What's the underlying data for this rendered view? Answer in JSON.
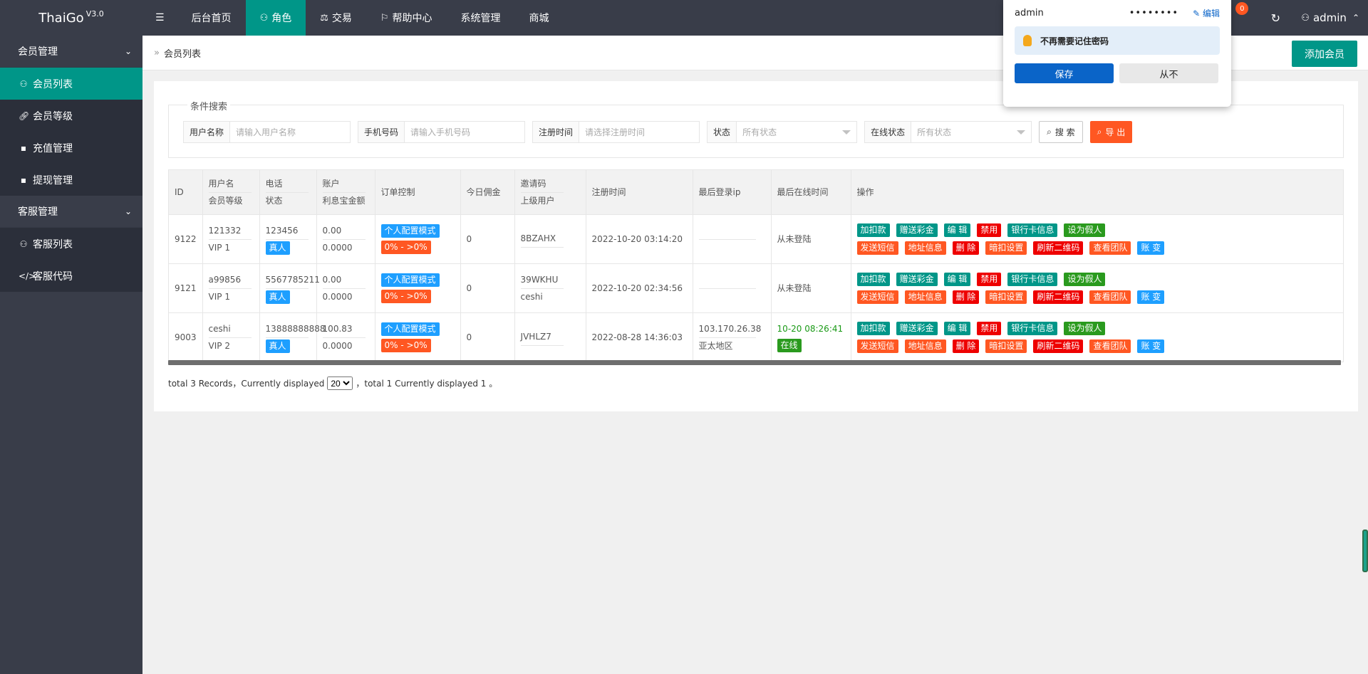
{
  "app": {
    "name": "ThaiGo",
    "version": "V3.0"
  },
  "topnav": {
    "items": [
      {
        "label": "后台首页",
        "icon": ""
      },
      {
        "label": "角色",
        "icon": "user-icon",
        "active": true
      },
      {
        "label": "交易",
        "icon": "scale-icon"
      },
      {
        "label": "帮助中心",
        "icon": "flag-icon"
      },
      {
        "label": "系统管理",
        "icon": ""
      },
      {
        "label": "商城",
        "icon": ""
      }
    ],
    "badge": "0",
    "user": "admin"
  },
  "sidebar": {
    "groups": [
      {
        "label": "会员管理",
        "items": [
          {
            "label": "会员列表",
            "icon": "user-icon",
            "active": true
          },
          {
            "label": "会员等级",
            "icon": "link-icon"
          },
          {
            "label": "充值管理",
            "icon": "chat-icon"
          },
          {
            "label": "提现管理",
            "icon": "chat-icon"
          }
        ]
      },
      {
        "label": "客服管理",
        "items": [
          {
            "label": "客服列表",
            "icon": "users-icon"
          },
          {
            "label": "客服代码",
            "icon": "code-icon"
          }
        ]
      }
    ]
  },
  "breadcrumb": {
    "current": "会员列表"
  },
  "add_button": "添加会员",
  "search": {
    "legend": "条件搜索",
    "username_label": "用户名称",
    "username_placeholder": "请输入用户名称",
    "phone_label": "手机号码",
    "phone_placeholder": "请输入手机号码",
    "regtime_label": "注册时间",
    "regtime_placeholder": "请选择注册时间",
    "status_label": "状态",
    "status_value": "所有状态",
    "online_label": "在线状态",
    "online_value": "所有状态",
    "search_button": "搜 索",
    "export_button": "导 出"
  },
  "table": {
    "headers": {
      "id": "ID",
      "user1": "用户名",
      "user2": "会员等级",
      "phone1": "电话",
      "phone2": "状态",
      "acct1": "账户",
      "acct2": "利息宝金额",
      "order": "订单控制",
      "commission": "今日佣金",
      "invite1": "邀请码",
      "invite2": "上级用户",
      "regtime": "注册时间",
      "lastip": "最后登录ip",
      "lastonline": "最后在线时间",
      "ops": "操作"
    },
    "rows": [
      {
        "id": "9122",
        "username": "121332",
        "level": "VIP 1",
        "phone": "123456",
        "status": "真人",
        "balance": "0.00",
        "interest": "0.0000",
        "order_mode": "个人配置模式",
        "order_range": "0% - >0%",
        "commission": "0",
        "invite": "8BZAHX",
        "parent": "",
        "regtime": "2022-10-20 03:14:20",
        "ip": "",
        "region": "",
        "last_online": "从未登陆",
        "online_tag": ""
      },
      {
        "id": "9121",
        "username": "a99856",
        "level": "VIP 1",
        "phone": "5567785211",
        "status": "真人",
        "balance": "0.00",
        "interest": "0.0000",
        "order_mode": "个人配置模式",
        "order_range": "0% - >0%",
        "commission": "0",
        "invite": "39WKHU",
        "parent": "ceshi",
        "regtime": "2022-10-20 02:34:56",
        "ip": "",
        "region": "",
        "last_online": "从未登陆",
        "online_tag": ""
      },
      {
        "id": "9003",
        "username": "ceshi",
        "level": "VIP 2",
        "phone": "13888888888",
        "status": "真人",
        "balance": "100.83",
        "interest": "0.0000",
        "order_mode": "个人配置模式",
        "order_range": "0% - >0%",
        "commission": "0",
        "invite": "JVHLZ7",
        "parent": "",
        "regtime": "2022-08-28 14:36:03",
        "ip": "103.170.26.38",
        "region": "亚太地区",
        "last_online": "10-20 08:26:41",
        "online_tag": "在线"
      }
    ],
    "ops_row1": [
      "加扣款",
      "赠送彩金",
      "编 辑",
      "禁用",
      "银行卡信息",
      "设为假人"
    ],
    "ops_row2": [
      "发送短信",
      "地址信息",
      "删 除",
      "暗扣设置",
      "刷新二维码",
      "查看团队",
      "账 变"
    ]
  },
  "pager": {
    "prefix": "total 3 Records，Currently displayed",
    "page_size": "20",
    "suffix": "，total 1 Currently displayed 1 。"
  },
  "password_popup": {
    "username": "admin",
    "password_mask": "••••••••",
    "edit_label": "编辑",
    "tip": "不再需要记住密码",
    "save": "保存",
    "never": "从不"
  }
}
